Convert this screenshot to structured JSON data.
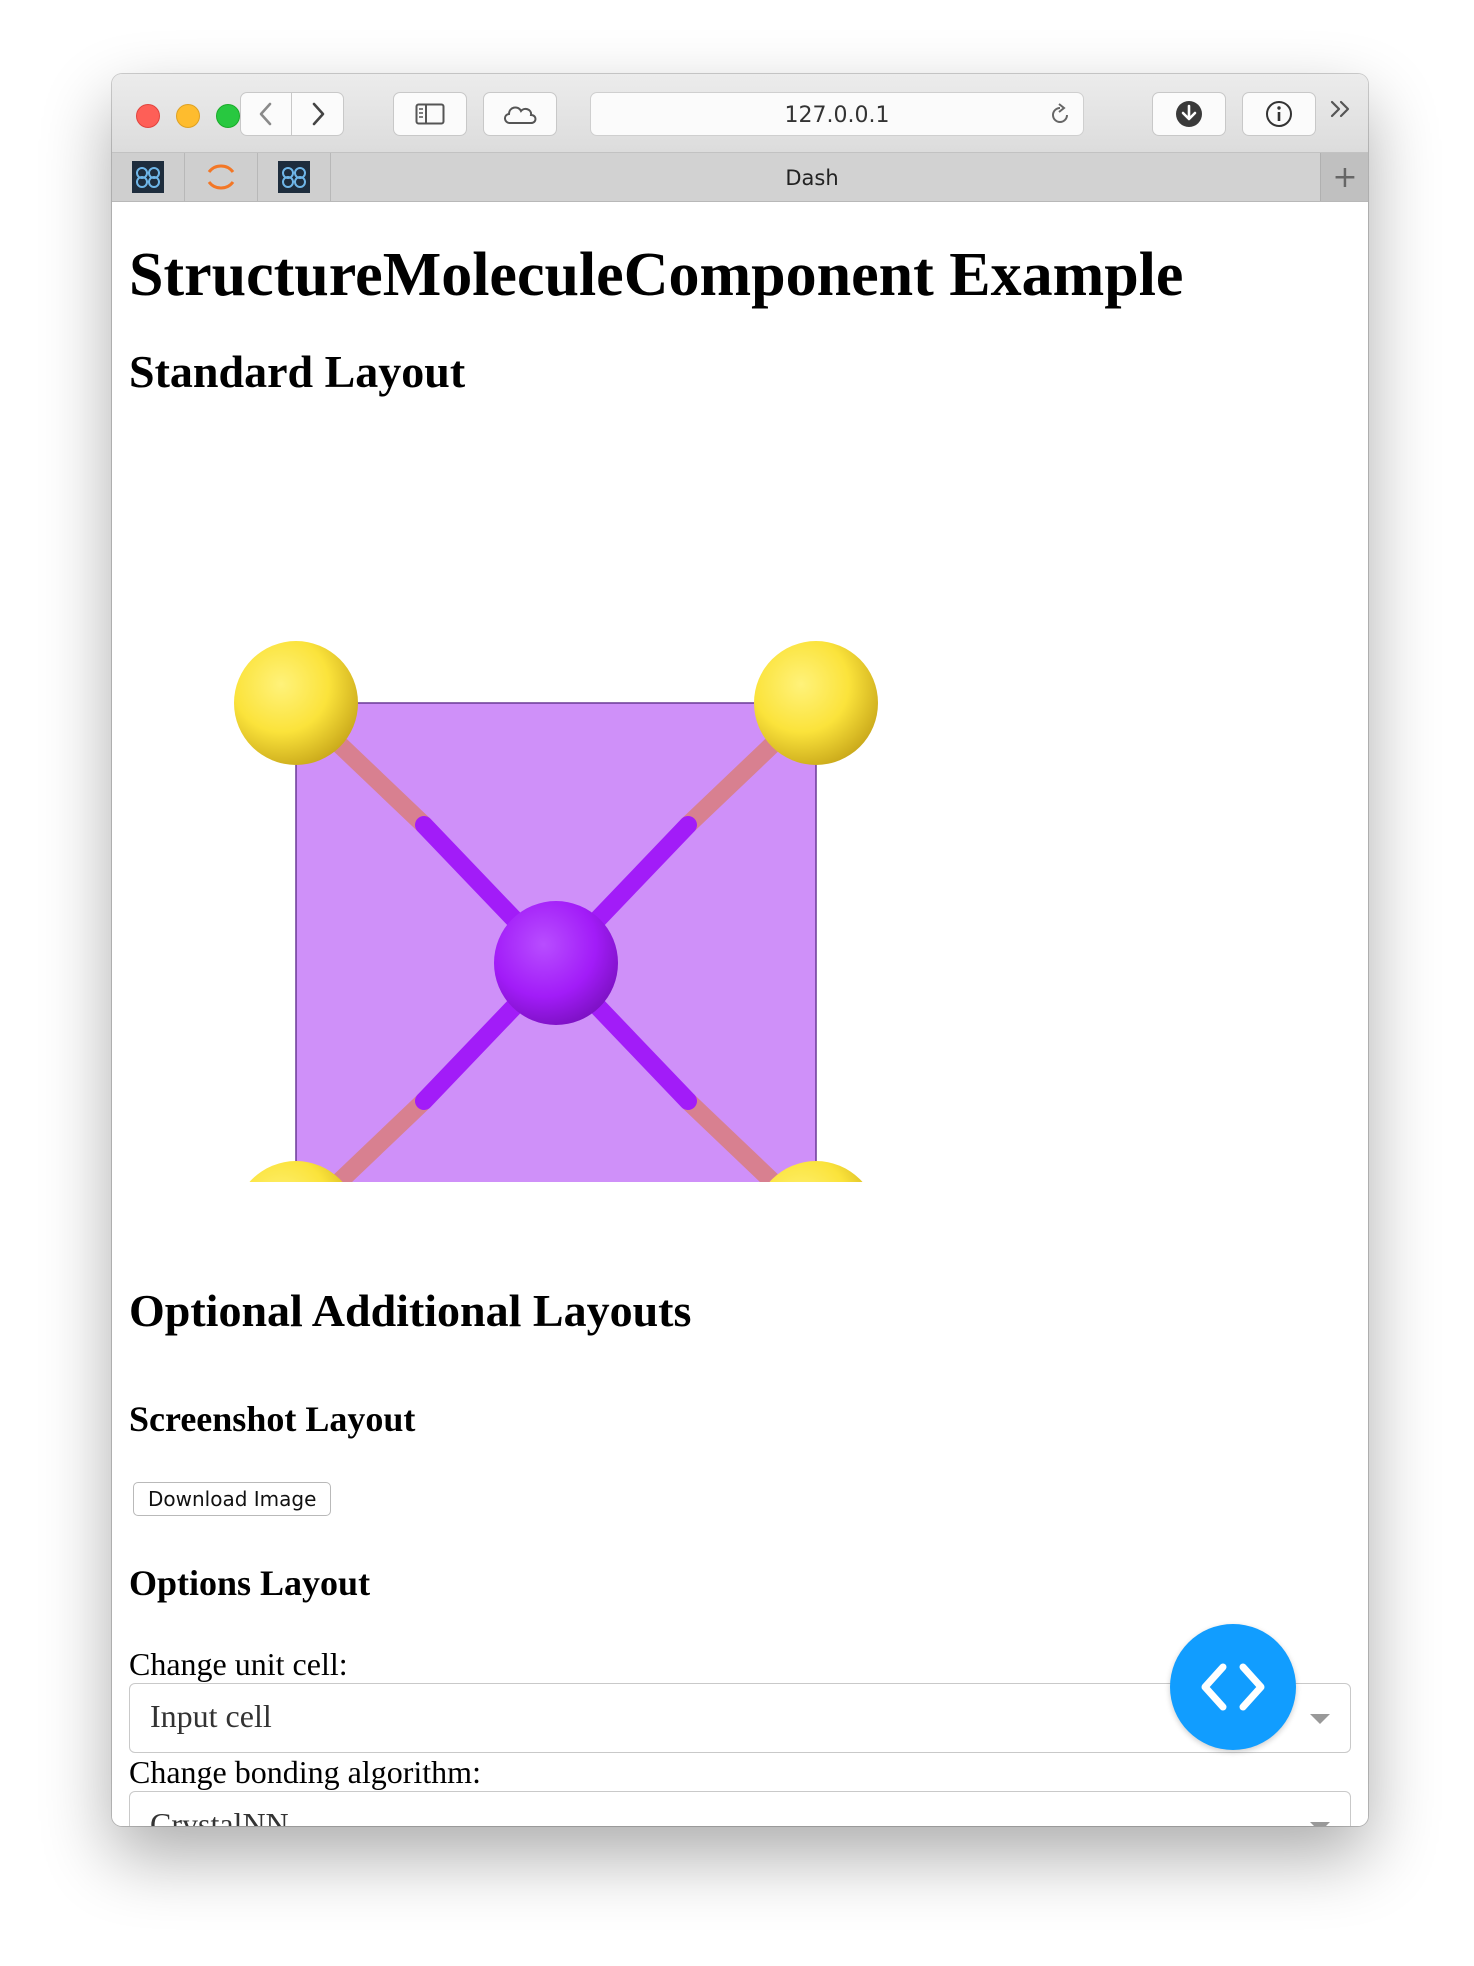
{
  "browser": {
    "url": "127.0.0.1",
    "tab_title": "Dash",
    "new_tab_label": "+"
  },
  "page": {
    "title": "StructureMoleculeComponent Example",
    "standard_layout_heading": "Standard Layout",
    "optional_layouts_heading": "Optional Additional Layouts",
    "screenshot_layout_heading": "Screenshot Layout",
    "download_button_label": "Download Image",
    "options_layout_heading": "Options Layout",
    "unit_cell_label": "Change unit cell:",
    "unit_cell_value": "Input cell",
    "bonding_label": "Change bonding algorithm:",
    "bonding_value": "CrystalNN"
  },
  "structure_viewer": {
    "polyhedron_color": "#cf90f9",
    "center_atom_color": "#a21cf8",
    "corner_atom_color": "#fbe33b",
    "bond_color_inner": "#a21cf8",
    "bond_color_outer": "#d88090"
  },
  "colors": {
    "fab": "#119dff"
  },
  "icons": {
    "back": "chevron-left-icon",
    "forward": "chevron-right-icon",
    "sidebar": "sidebar-icon",
    "cloud": "cloud-icon",
    "reload": "reload-icon",
    "download": "download-icon",
    "info": "info-icon",
    "overflow": "double-chevron-icon",
    "debug": "code-brackets-icon"
  }
}
